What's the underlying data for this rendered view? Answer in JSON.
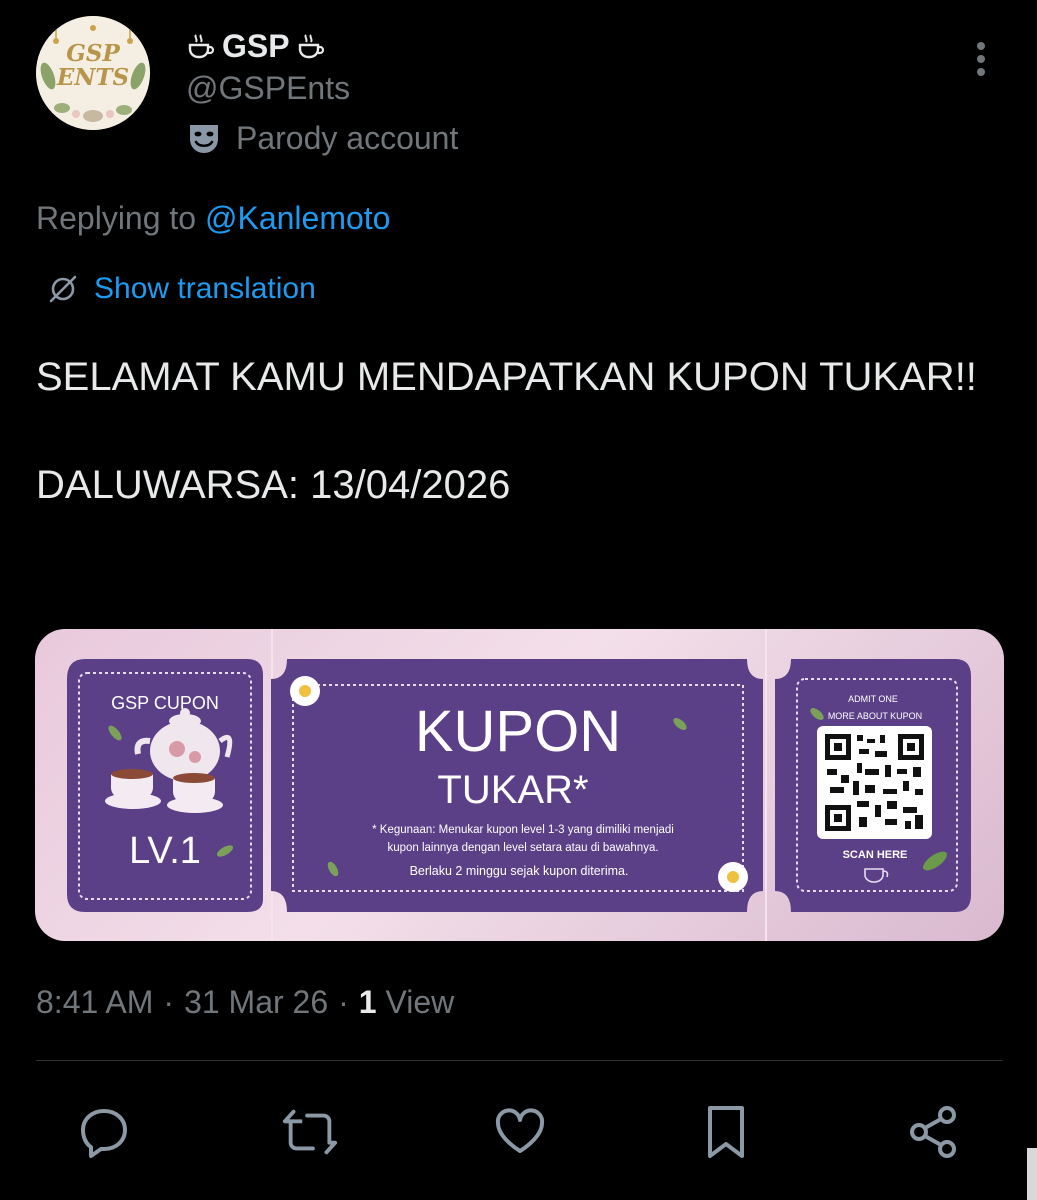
{
  "author": {
    "avatar_text_line1": "GSP",
    "avatar_text_line2": "ENTS",
    "display_name": "GSP",
    "handle": "@GSPEnts",
    "label": "Parody account"
  },
  "reply": {
    "prefix": "Replying to",
    "mention": "@Kanlemoto"
  },
  "translation_link": "Show translation",
  "tweet": {
    "text": "SELAMAT KAMU MENDAPATKAN KUPON TUKAR!!\n\nDALUWARSA: 13/04/2026"
  },
  "coupon": {
    "brand": "GSP CUPON",
    "level": "LV.1",
    "title": "KUPON",
    "subtitle": "TUKAR*",
    "desc_line1": "* Kegunaan: Menukar kupon level 1-3 yang dimiliki menjadi",
    "desc_line2": "kupon lainnya dengan level setara atau di bawahnya.",
    "validity": "Berlaku 2 minggu sejak kupon diterima.",
    "admit": "ADMIT ONE",
    "more": "MORE ABOUT KUPON",
    "scan": "SCAN HERE"
  },
  "meta": {
    "time": "8:41 AM",
    "dot": "·",
    "date": "31 Mar 26",
    "views_count": "1",
    "views_label": "View"
  },
  "actions": {
    "reply_icon": "reply-icon",
    "retweet_icon": "retweet-icon",
    "like_icon": "like-icon",
    "bookmark_icon": "bookmark-icon",
    "share_icon": "share-icon"
  },
  "colors": {
    "background": "#000000",
    "text": "#e7e9ea",
    "secondary": "#71767b",
    "link": "#1d9bf0",
    "coupon_purple": "#5b3f87",
    "coupon_pink": "#ecd2e1"
  }
}
